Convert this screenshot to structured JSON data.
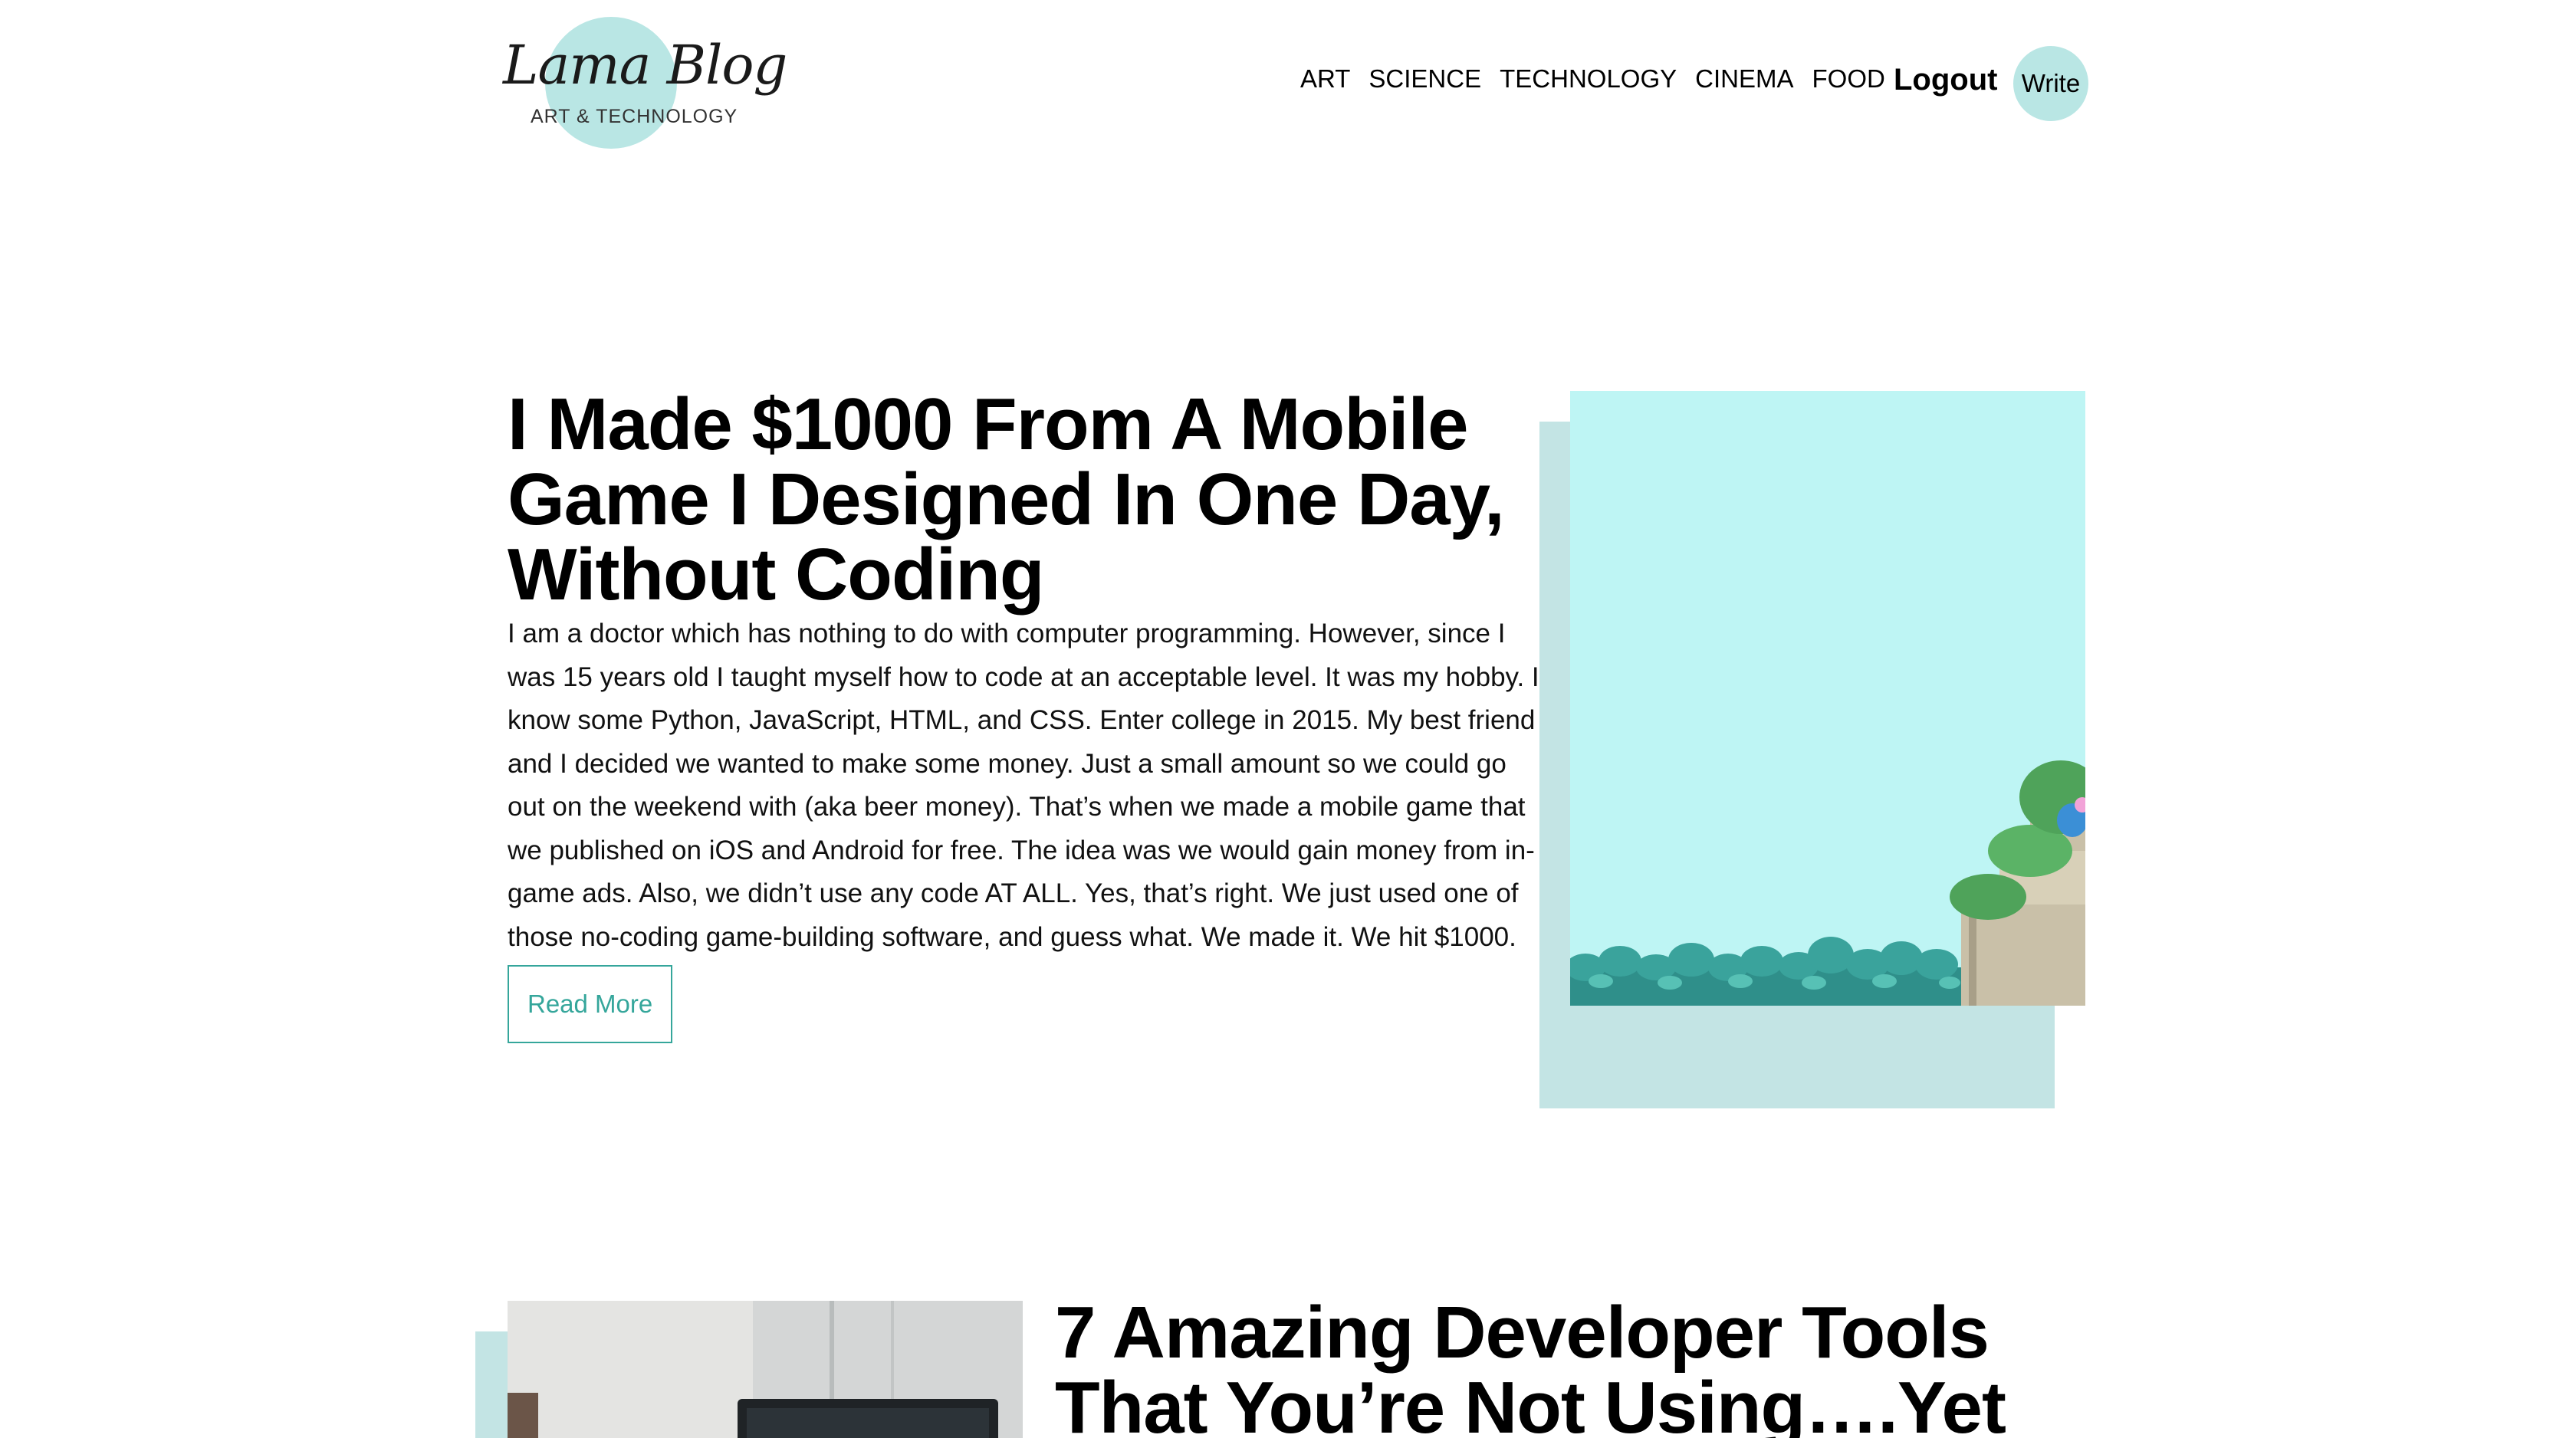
{
  "logo": {
    "title": "Lama Blog",
    "subtitle": "ART & TECHNOLOGY"
  },
  "nav": {
    "links": [
      "ART",
      "SCIENCE",
      "TECHNOLOGY",
      "CINEMA",
      "FOOD"
    ],
    "logout": "Logout",
    "write": "Write"
  },
  "colors": {
    "accent": "#b9e6e4",
    "shadow": "#c3e4e4",
    "button": "#35a69b",
    "game_sky": "#bef5f4"
  },
  "posts": [
    {
      "title": "I Made $1000 From A Mobile Game I Designed In One Day, Without Coding",
      "desc": "I am a doctor which has nothing to do with computer programming. However, since I was 15 years old I taught myself how to code at an acceptable level. It was my hobby. I know some Python, JavaScript, HTML, and CSS. Enter college in 2015. My best friend and I decided we wanted to make some money. Just a small amount so we could go out on the weekend with (aka beer money). That’s when we made a mobile game that we published on iOS and Android for free. The idea was we would gain money from in-game ads. Also, we didn’t use any code AT ALL. Yes, that’s right. We just used one of those no-coding game-building software, and guess what. We made it. We hit $1000.",
      "button": "Read More"
    },
    {
      "title": "7 Amazing Developer Tools That You’re Not Using….Yet"
    }
  ]
}
